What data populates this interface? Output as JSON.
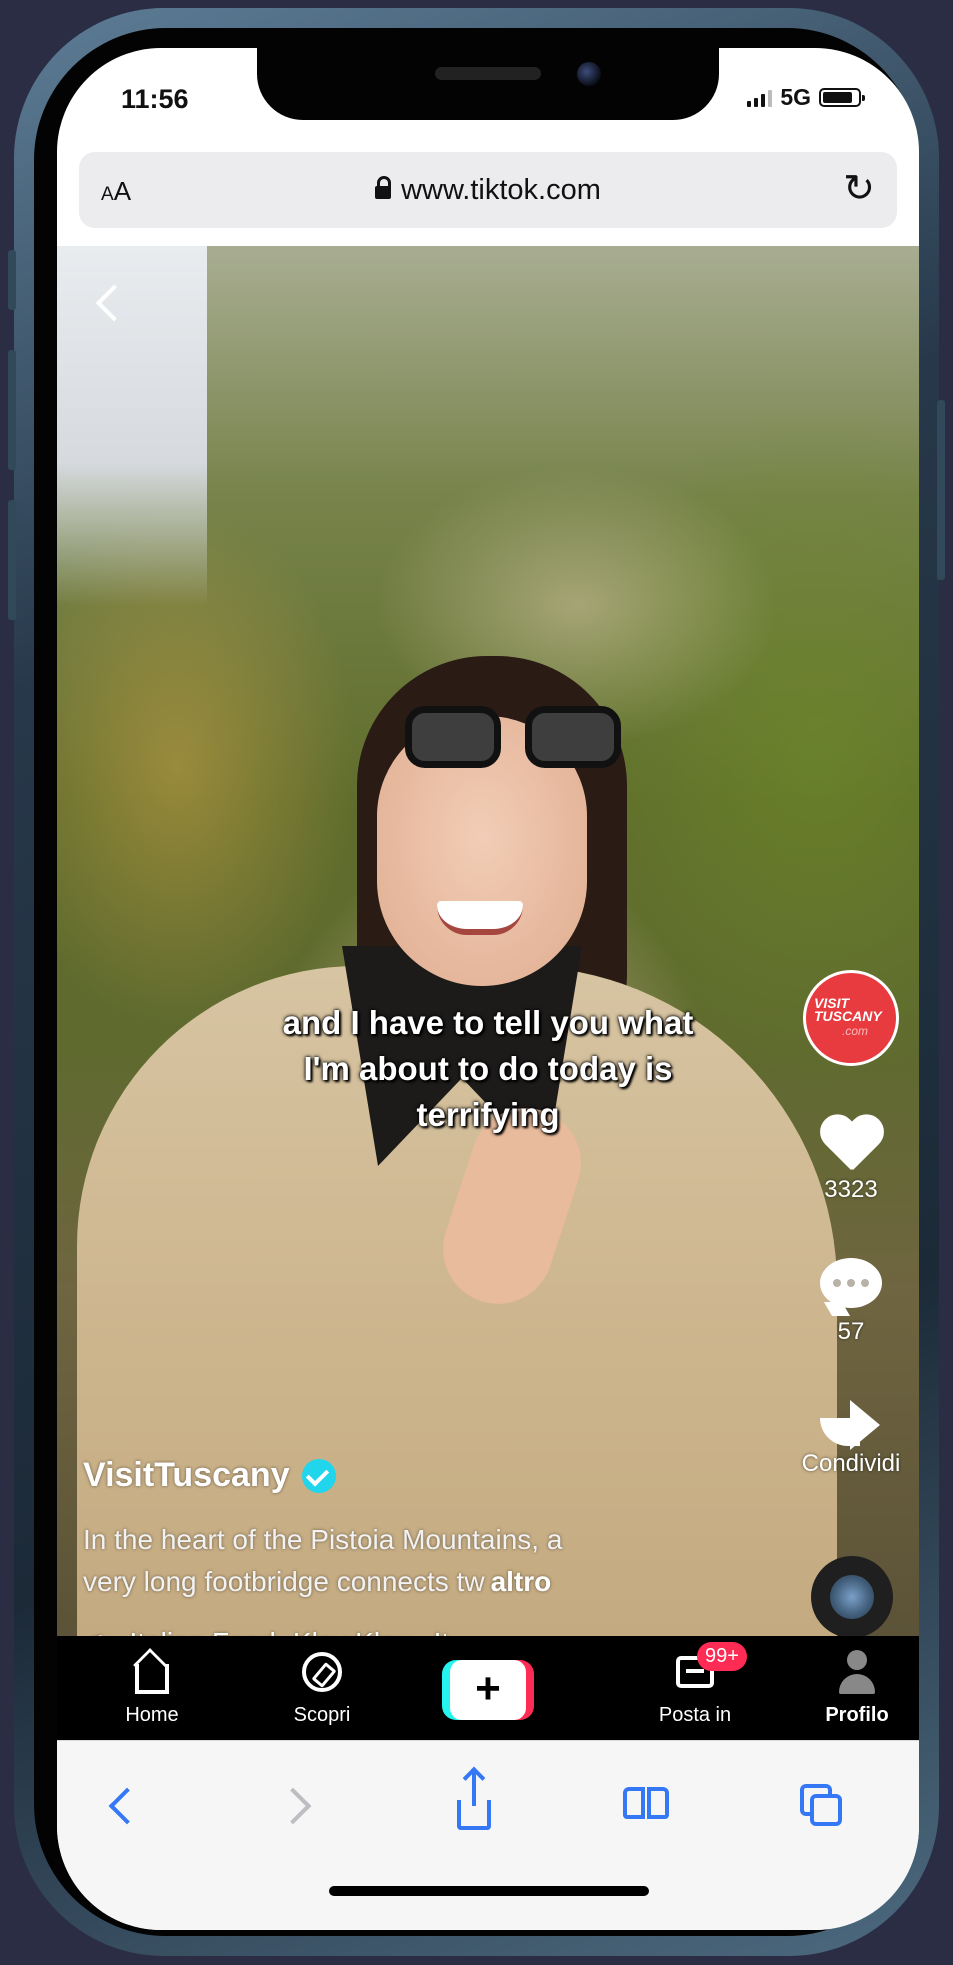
{
  "status_bar": {
    "time": "11:56",
    "network": "5G"
  },
  "browser": {
    "text_size_label_big": "A",
    "text_size_label_small": "A",
    "url": "www.tiktok.com"
  },
  "video": {
    "caption_lines": [
      "and I have to tell you what",
      "I'm about to do today is",
      "terrifying"
    ],
    "account_avatar": {
      "line1": "VISIT",
      "line2": "TUSCANY",
      "line3": ".com"
    },
    "likes": "3323",
    "comments": "57",
    "share_label": "Condividi",
    "username": "VisitTuscany",
    "description_line1": "In the heart of the Pistoia Mountains, a",
    "description_line2": "very long footbridge connects tw",
    "more_label": "altro",
    "music_title": "Italian Food- Kley Kley",
    "music_trail": "It"
  },
  "tiktok_nav": {
    "home": "Home",
    "discover": "Scopri",
    "create": "+",
    "inbox": "Posta in",
    "inbox_badge": "99+",
    "profile": "Profilo"
  },
  "colors": {
    "accent": "#3478f6",
    "tiktok_pink": "#fe2c55",
    "tiktok_cyan": "#25f4ee",
    "verified": "#20d5ec",
    "avatar_red": "#e73b3f"
  },
  "icons": [
    "back-chevron-icon",
    "lock-icon",
    "reload-icon",
    "heart-icon",
    "comment-icon",
    "share-icon",
    "music-note-icon",
    "home-icon",
    "compass-icon",
    "inbox-icon",
    "profile-icon",
    "safari-back-icon",
    "safari-forward-icon",
    "safari-share-icon",
    "bookmarks-icon",
    "tabs-icon"
  ]
}
